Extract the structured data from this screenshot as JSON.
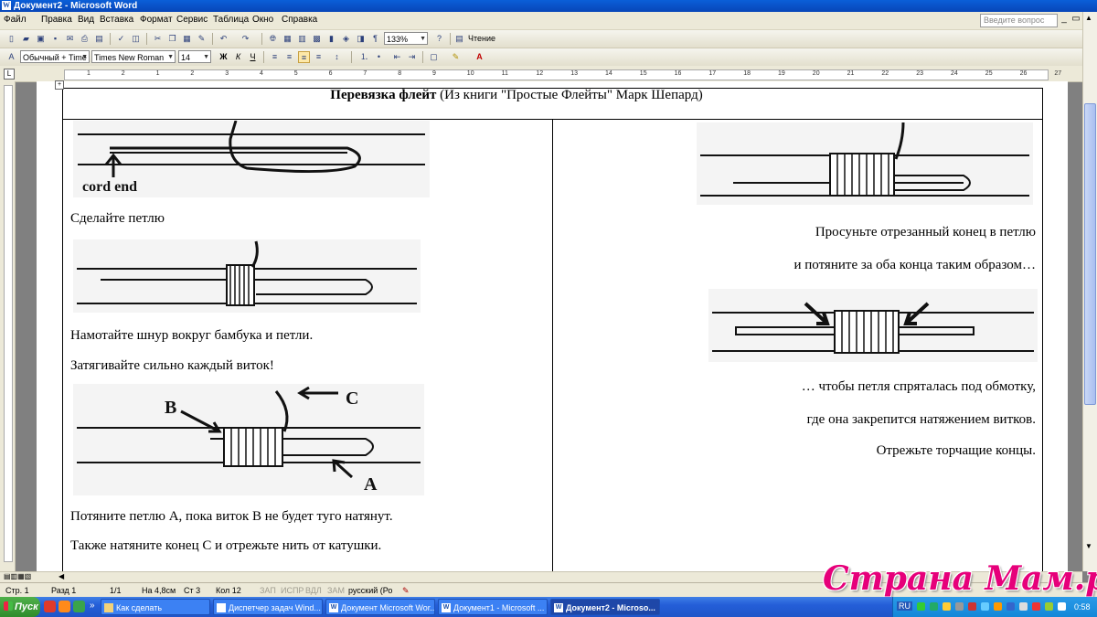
{
  "window": {
    "title": "Документ2 - Microsoft Word"
  },
  "menu": {
    "items": [
      "Файл",
      "Правка",
      "Вид",
      "Вставка",
      "Формат",
      "Сервис",
      "Таблица",
      "Окно",
      "Справка"
    ],
    "ask_placeholder": "Введите вопрос"
  },
  "toolbar": {
    "zoom": "133%",
    "reading": "Чтение"
  },
  "format_bar": {
    "style": "Обычный + Time",
    "font": "Times New Roman",
    "size": "14",
    "bold": "Ж",
    "italic": "К",
    "underline": "Ч"
  },
  "ruler_numbers": [
    "1",
    "2",
    "1",
    "2",
    "3",
    "4",
    "5",
    "6",
    "7",
    "8",
    "9",
    "10",
    "11",
    "12",
    "13",
    "14",
    "15",
    "16",
    "17",
    "18",
    "19",
    "20",
    "21",
    "22",
    "23",
    "24",
    "25",
    "26",
    "27",
    "28"
  ],
  "document": {
    "heading_bold": "Перевязка флейт",
    "heading_rest": " (Из книги \"Простые Флейты\" Марк Шепард)",
    "left": {
      "fig1_label": "cord end",
      "p1": "Сделайте петлю",
      "p2": "Намотайте шнур вокруг бамбука и петли.",
      "p3": "Затягивайте сильно каждый виток!",
      "fig3_labels": [
        "B",
        "C",
        "A"
      ],
      "p4": "Потяните петлю А, пока виток В не будет туго натянут.",
      "p5": "Также натяните конец С и отрежьте нить от катушки."
    },
    "right": {
      "p1": "Просуньте отрезанный конец в петлю",
      "p2": "и потяните за оба конца таким образом…",
      "p3": "… чтобы петля спряталась под обмотку,",
      "p4": "где она закрепится натяжением витков.",
      "p5": "Отрежьте торчащие концы."
    }
  },
  "status": {
    "page": "Стр. 1",
    "section": "Разд 1",
    "pages": "1/1",
    "at": "На 4,8см",
    "line": "Ст 3",
    "col": "Кол 12",
    "rec": "ЗАП",
    "trk": "ИСПР",
    "ext": "ВДЛ",
    "ovr": "ЗАМ",
    "lang": "русский (Ро"
  },
  "taskbar": {
    "start": "Пуск",
    "tasks": [
      "Как сделать",
      "Диспетчер задач Wind...",
      "Документ Microsoft Wor...",
      "Документ1 - Microsoft ...",
      "Документ2 - Microso..."
    ],
    "lang": "RU",
    "clock": "0:58"
  },
  "watermark": "Страна Мам.ру"
}
